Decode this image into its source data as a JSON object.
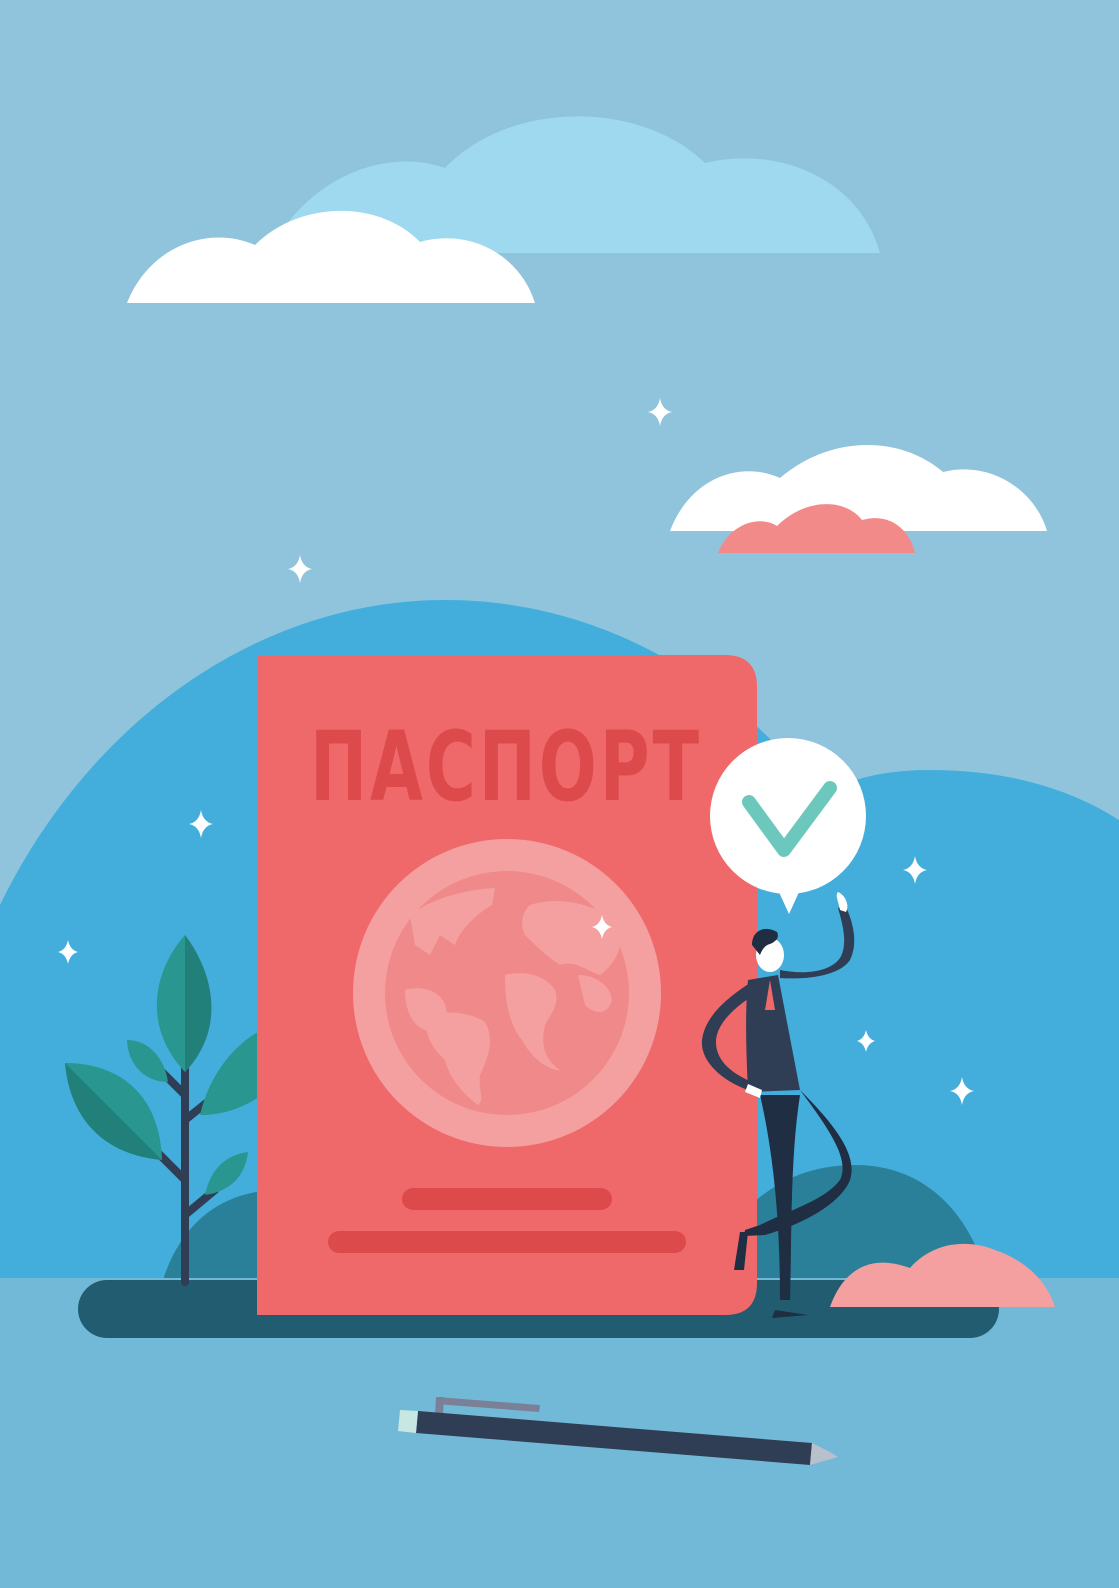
{
  "passport": {
    "title": "ПАСПОРТ"
  },
  "colors": {
    "sky": "#90c4dc",
    "hill_blue": "#43aedc",
    "ground": "#72b9d8",
    "passport_cover": "#f0696a",
    "passport_text": "#dc4a4c",
    "globe_light": "#f5a0a0",
    "cloud_white": "#ffffff",
    "cloud_pink": "#f28a8a",
    "leaf_teal": "#2a9690",
    "check_mark": "#6cc8bd",
    "suit_dark": "#2f3d55"
  },
  "icons": {
    "approval": "check-mark-icon",
    "sparkle": "sparkle-icon"
  }
}
